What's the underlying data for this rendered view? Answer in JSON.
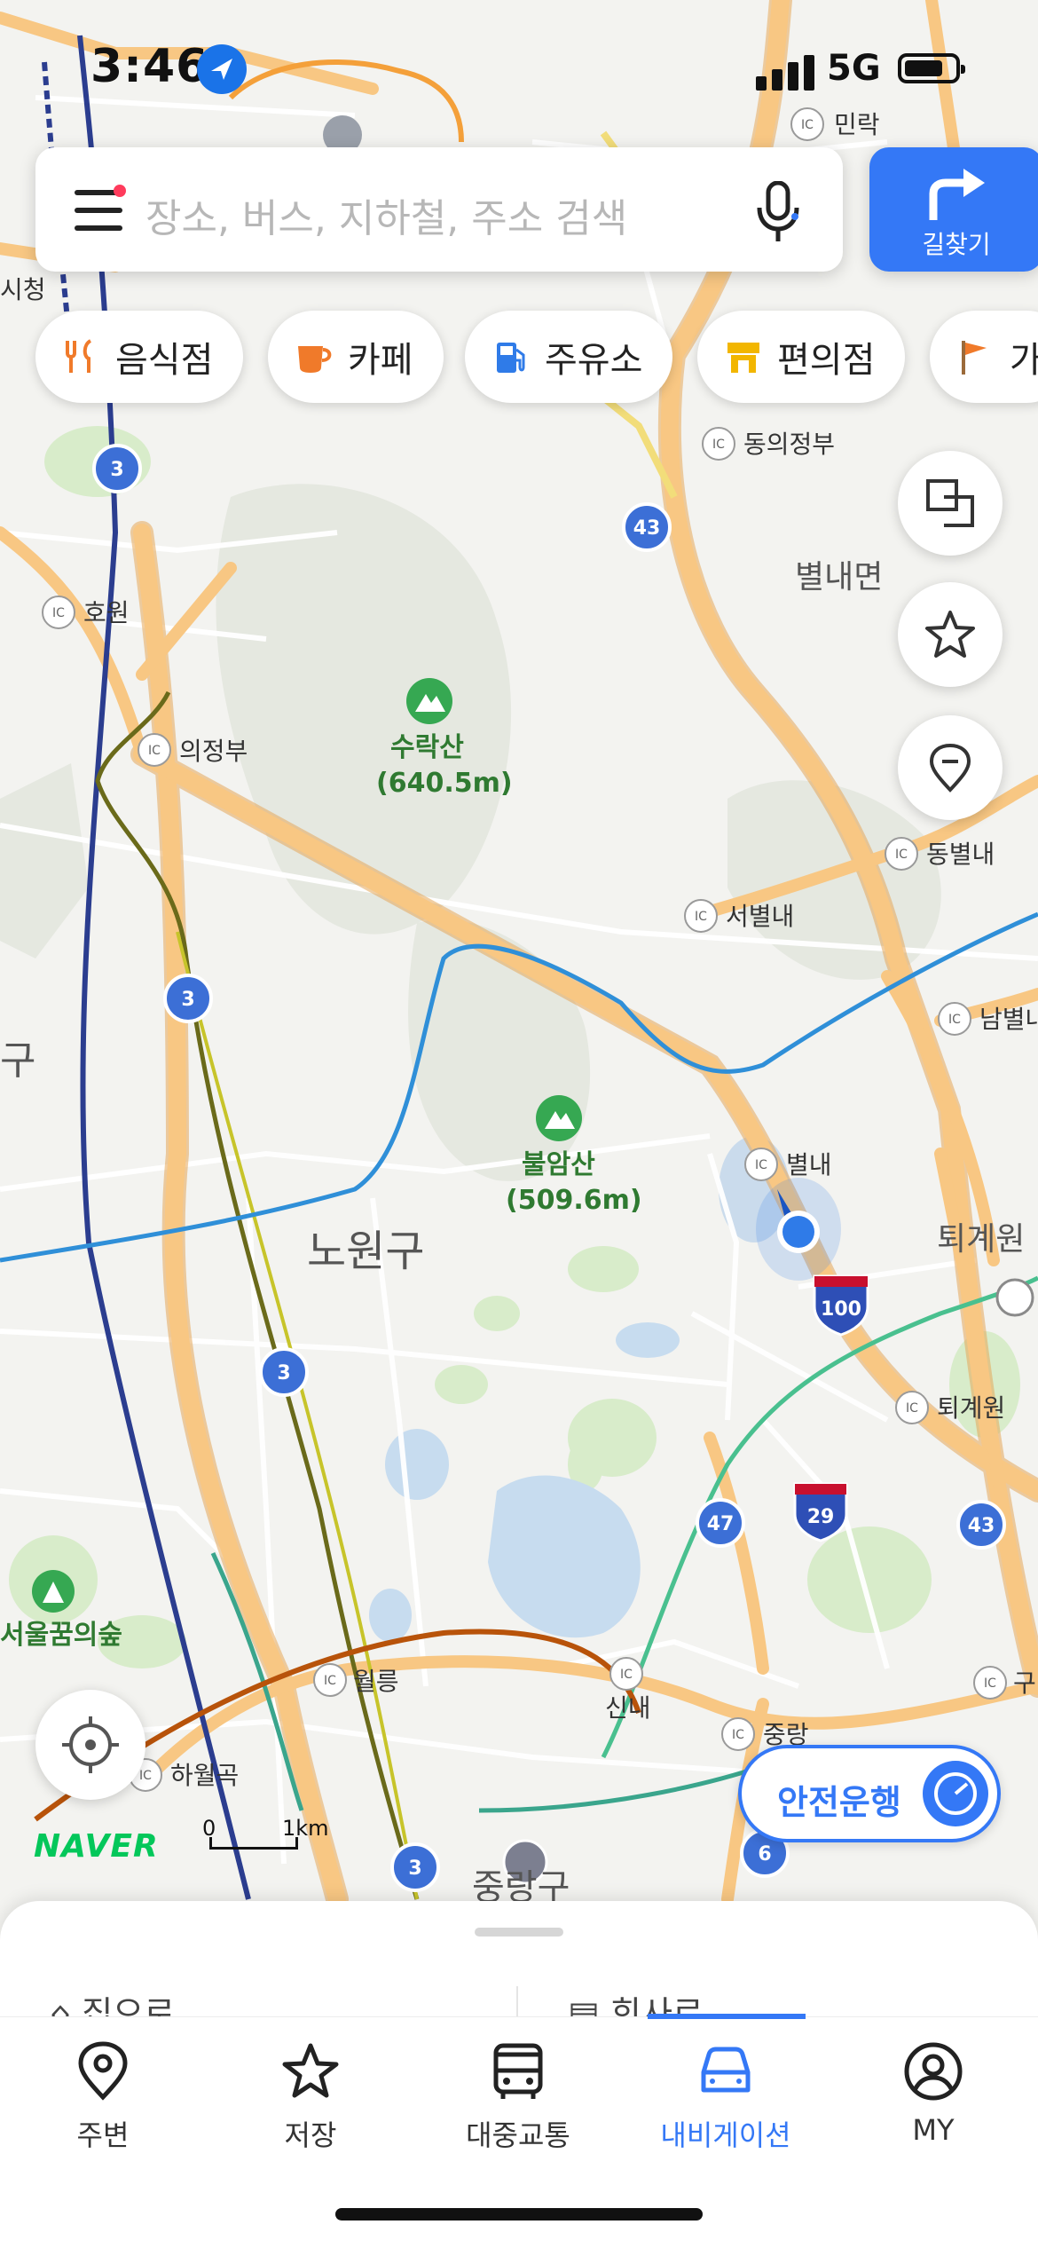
{
  "status": {
    "time": "3:46",
    "network": "5G"
  },
  "search": {
    "placeholder": "장소, 버스, 지하철, 주소 검색",
    "route_label": "길찾기"
  },
  "chips": [
    {
      "label": "음식점",
      "icon": "fork-knife-icon",
      "color": "#f07a2a"
    },
    {
      "label": "카페",
      "icon": "coffee-cup-icon",
      "color": "#f07a2a"
    },
    {
      "label": "주유소",
      "icon": "gas-pump-icon",
      "color": "#2f7be8"
    },
    {
      "label": "편의점",
      "icon": "store-icon",
      "color": "#f2b600"
    },
    {
      "label": "가",
      "icon": "flag-icon",
      "color": "#9b6a3a"
    }
  ],
  "map": {
    "places": [
      {
        "name": "민락"
      },
      {
        "name": "시청"
      },
      {
        "name": "동의정부"
      },
      {
        "name": "별내면"
      },
      {
        "name": "호원"
      },
      {
        "name": "의정부"
      },
      {
        "name": "수락산"
      },
      {
        "name": "(640.5m)"
      },
      {
        "name": "동별내"
      },
      {
        "name": "서별내"
      },
      {
        "name": "남별내"
      },
      {
        "name": "구"
      },
      {
        "name": "불암산"
      },
      {
        "name": "(509.6m)"
      },
      {
        "name": "별내"
      },
      {
        "name": "노원구"
      },
      {
        "name": "퇴계원"
      },
      {
        "name": "퇴계원"
      },
      {
        "name": "서울꿈의숲"
      },
      {
        "name": "월릉"
      },
      {
        "name": "신내"
      },
      {
        "name": "중랑"
      },
      {
        "name": "하월곡"
      },
      {
        "name": "구"
      },
      {
        "name": "중랑구"
      }
    ],
    "route_shields": [
      "3",
      "43",
      "3",
      "3",
      "100",
      "47",
      "29",
      "43",
      "6",
      "3"
    ],
    "colors": {
      "road": "#f6c277",
      "road_edge": "#e6a85a",
      "water": "#b8d4ee",
      "green": "#cfe7bf",
      "line_blue": "#2f8fd8",
      "line_navy": "#2b3d8f"
    }
  },
  "buttons": {
    "safe_drive": "안전운행"
  },
  "brand": {
    "logo": "NAVER",
    "scale_zero": "0",
    "scale_km": "1km"
  },
  "sheet": {
    "home": "집으로",
    "work": "회사로"
  },
  "tabs": [
    {
      "label": "주변",
      "icon": "location-pin-icon"
    },
    {
      "label": "저장",
      "icon": "star-icon"
    },
    {
      "label": "대중교통",
      "icon": "bus-icon"
    },
    {
      "label": "내비게이션",
      "icon": "car-icon",
      "active": true
    },
    {
      "label": "MY",
      "icon": "profile-icon"
    }
  ]
}
